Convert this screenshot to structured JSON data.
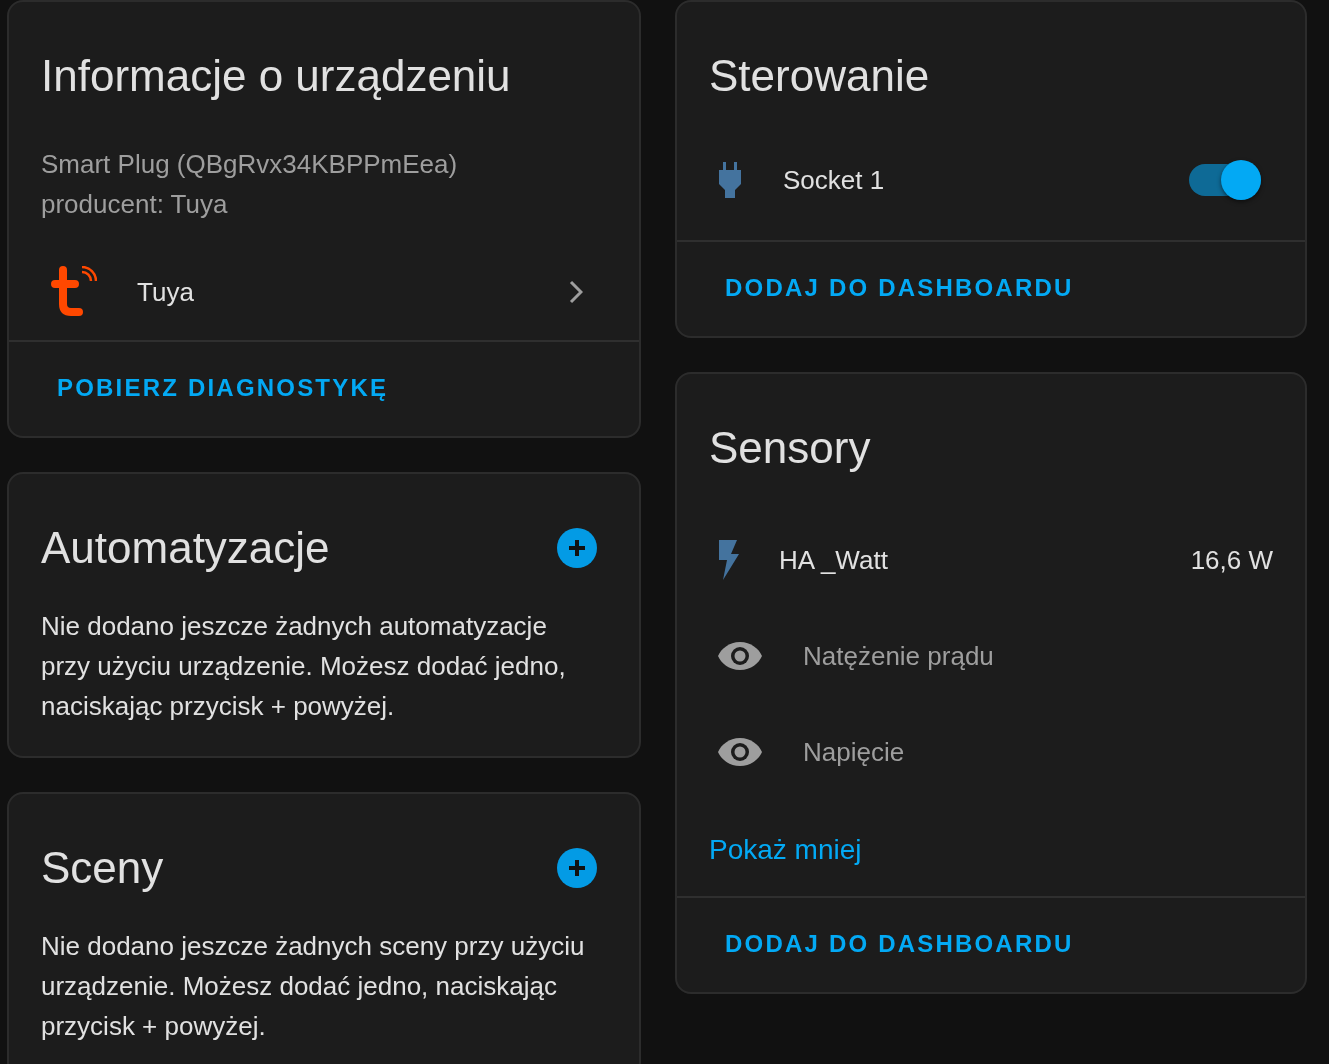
{
  "device_info": {
    "title": "Informacje o urządzeniu",
    "model": "Smart Plug (QBgRvx34KBPPmEea)",
    "manufacturer": "producent: Tuya",
    "integration": "Tuya",
    "action": "POBIERZ DIAGNOSTYKĘ"
  },
  "automations": {
    "title": "Automatyzacje",
    "text": "Nie dodano jeszcze żadnych automatyzacje przy użyciu urządzenie. Możesz dodać jedno, naciskając przycisk + powyżej."
  },
  "scenes": {
    "title": "Sceny",
    "text": "Nie dodano jeszcze żadnych sceny przy użyciu urządzenie. Możesz dodać jedno, naciskając przycisk + powyżej."
  },
  "controls": {
    "title": "Sterowanie",
    "entities": [
      {
        "name": "Socket 1",
        "kind": "plug",
        "on": true
      }
    ],
    "action": "DODAJ DO DASHBOARDU"
  },
  "sensors": {
    "title": "Sensory",
    "entities": [
      {
        "name": "HA _Watt",
        "kind": "power",
        "value": "16,6 W",
        "disabled": false
      },
      {
        "name": "Natężenie prądu",
        "kind": "hidden",
        "disabled": true
      },
      {
        "name": "Napięcie",
        "kind": "hidden",
        "disabled": true
      }
    ],
    "show_less": "Pokaż mniej",
    "action": "DODAJ DO DASHBOARDU"
  }
}
